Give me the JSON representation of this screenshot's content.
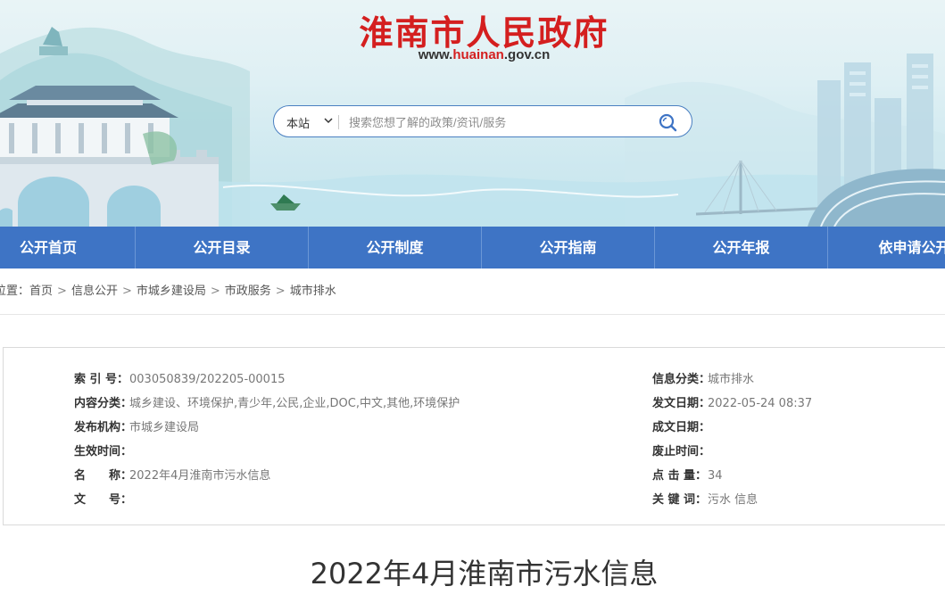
{
  "header": {
    "site_title": "淮南市人民政府",
    "url_prefix": "www.",
    "url_highlight": "huainan",
    "url_suffix": ".gov.cn"
  },
  "search": {
    "scope_label": "本站",
    "placeholder": "搜索您想了解的政策/资讯/服务",
    "value": ""
  },
  "nav": {
    "items": [
      "公开首页",
      "公开目录",
      "公开制度",
      "公开指南",
      "公开年报",
      "依申请公开"
    ]
  },
  "breadcrumb": {
    "lead": "位置：",
    "items": [
      "首页",
      "信息公开",
      "市城乡建设局",
      "市政服务",
      "城市排水"
    ],
    "separator": ">"
  },
  "info": {
    "left": [
      {
        "label": "索 引 号：",
        "value": "003050839/202205-00015"
      },
      {
        "label": "内容分类：",
        "value": "城乡建设、环境保护,青少年,公民,企业,DOC,中文,其他,环境保护"
      },
      {
        "label": "发布机构：",
        "value": "市城乡建设局"
      },
      {
        "label": "生效时间：",
        "value": ""
      },
      {
        "label": "名　　称：",
        "value": "2022年4月淮南市污水信息"
      },
      {
        "label": "文　　号：",
        "value": ""
      }
    ],
    "right": [
      {
        "label": "信息分类：",
        "value": "城市排水"
      },
      {
        "label": "发文日期：",
        "value": "2022-05-24 08:37"
      },
      {
        "label": "成文日期：",
        "value": ""
      },
      {
        "label": "废止时间：",
        "value": ""
      },
      {
        "label": "点 击 量：",
        "value": "34"
      },
      {
        "label": "关 键 词：",
        "value": "污水 信息"
      }
    ]
  },
  "article": {
    "title": "2022年4月淮南市污水信息"
  },
  "colors": {
    "brand_red": "#d41f1f",
    "nav_blue": "#3e74c5",
    "search_border": "#4a7fc1"
  }
}
